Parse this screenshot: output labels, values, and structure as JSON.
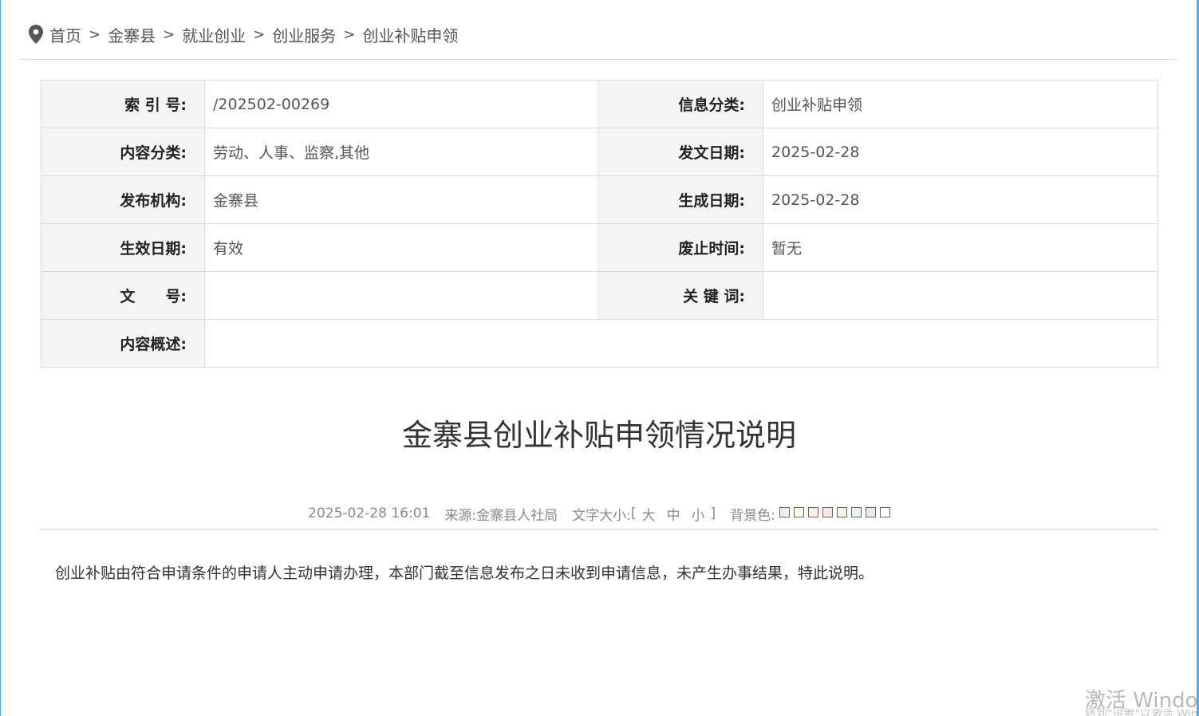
{
  "breadcrumb": {
    "items": [
      "首页",
      "金寨县",
      "就业创业",
      "创业服务",
      "创业补贴申领"
    ],
    "separator": ">"
  },
  "meta": {
    "rows": [
      [
        {
          "label": "索 引 号:",
          "value": "/202502-00269"
        },
        {
          "label": "信息分类:",
          "value": "创业补贴申领"
        }
      ],
      [
        {
          "label": "内容分类:",
          "value": "劳动、人事、监察,其他"
        },
        {
          "label": "发文日期:",
          "value": "2025-02-28"
        }
      ],
      [
        {
          "label": "发布机构:",
          "value": "金寨县"
        },
        {
          "label": "生成日期:",
          "value": "2025-02-28"
        }
      ],
      [
        {
          "label": "生效日期:",
          "value": "有效"
        },
        {
          "label": "废止时间:",
          "value": "暂无"
        }
      ],
      [
        {
          "label": "文　　号:",
          "value": ""
        },
        {
          "label": "关 键 词:",
          "value": ""
        }
      ]
    ],
    "summary": {
      "label": "内容概述:",
      "value": ""
    }
  },
  "article": {
    "title": "金寨县创业补贴申领情况说明",
    "datetime": "2025-02-28 16:01",
    "source_label": "来源:",
    "source": "金寨县人社局",
    "font_size_label": "文字大小:",
    "font_sizes": [
      "大",
      "中",
      "小"
    ],
    "bracket_open": "[",
    "bracket_close": "]",
    "bg_label": "背景色:",
    "bg_colors": [
      "#eeeeee",
      "#fbfbe6",
      "#fbeee2",
      "#fbe4e4",
      "#eef7e0",
      "#e4f5ee",
      "#e8e8ee",
      "#ffffff"
    ],
    "body": "创业补贴由符合申请条件的申请人主动申请办理，本部门截至信息发布之日未收到申请信息，未产生办事结果，特此说明。"
  },
  "watermark": {
    "text": "激活 Windows",
    "subtext": "转到\"设置\"以激活 Windows。"
  },
  "colors": {
    "frame": "#5aa9e6",
    "label_bg": "#f5f5f5",
    "border": "#dcdcdc"
  }
}
